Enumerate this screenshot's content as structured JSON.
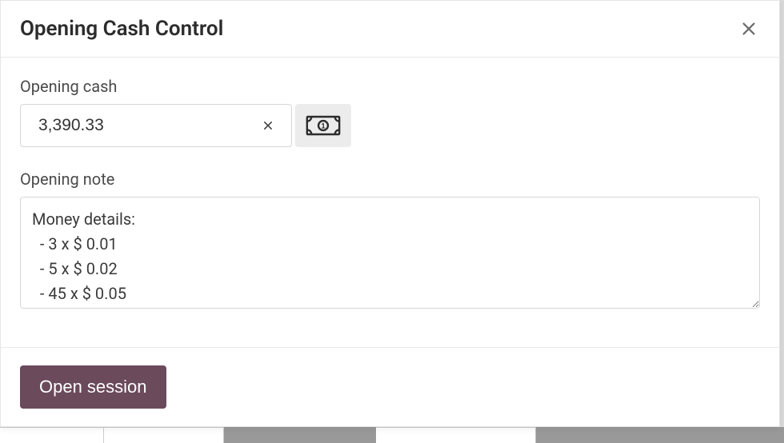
{
  "modal": {
    "title": "Opening Cash Control",
    "opening_cash_label": "Opening cash",
    "opening_cash_value": "3,390.33",
    "opening_note_label": "Opening note",
    "opening_note_value": "Money details:\n  - 3 x $ 0.01\n  - 5 x $ 0.02\n  - 45 x $ 0.05",
    "open_session_label": "Open session"
  }
}
